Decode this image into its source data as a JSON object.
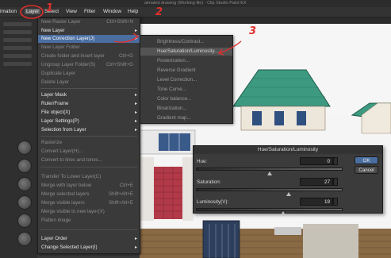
{
  "window": {
    "title_text": "aimated drawing (Working file) - Clip Studio Paint EX"
  },
  "menubar": {
    "items": [
      "imation",
      "Layer",
      "Select",
      "View",
      "Filter",
      "Window",
      "Help"
    ],
    "active": "Layer"
  },
  "layer_menu": {
    "items": [
      {
        "label": "New Raster Layer",
        "shortcut": "Ctrl+Shift+N",
        "submenu": false,
        "enabled": false
      },
      {
        "label": "New Layer",
        "shortcut": "",
        "submenu": true,
        "enabled": true
      },
      {
        "label": "New Correction Layer(J)",
        "shortcut": "",
        "submenu": true,
        "enabled": true,
        "highlighted": true
      },
      {
        "label": "New Layer Folder",
        "shortcut": "",
        "submenu": false,
        "enabled": false
      },
      {
        "label": "Create folder and insert layer",
        "shortcut": "Ctrl+G",
        "submenu": false,
        "enabled": false
      },
      {
        "label": "Ungroup Layer Folder(S)",
        "shortcut": "Ctrl+Shift+G",
        "submenu": false,
        "enabled": false
      },
      {
        "label": "Duplicate Layer",
        "shortcut": "",
        "submenu": false,
        "enabled": false
      },
      {
        "label": "Delete Layer",
        "shortcut": "",
        "submenu": false,
        "enabled": false
      },
      {
        "label": "Layer Mask",
        "shortcut": "",
        "submenu": true,
        "enabled": true
      },
      {
        "label": "Ruler/Frame",
        "shortcut": "",
        "submenu": true,
        "enabled": true
      },
      {
        "label": "File object(X)",
        "shortcut": "",
        "submenu": true,
        "enabled": true
      },
      {
        "label": "Layer Settings(P)",
        "shortcut": "",
        "submenu": true,
        "enabled": true
      },
      {
        "label": "Selection from Layer",
        "shortcut": "",
        "submenu": true,
        "enabled": true
      },
      {
        "label": "Rasterize",
        "shortcut": "",
        "submenu": false,
        "enabled": false
      },
      {
        "label": "Convert Layer(H)...",
        "shortcut": "",
        "submenu": false,
        "enabled": false
      },
      {
        "label": "Convert to lines and tones...",
        "shortcut": "",
        "submenu": false,
        "enabled": false
      },
      {
        "label": "Transfer To Lower Layer(C)",
        "shortcut": "",
        "submenu": false,
        "enabled": false
      },
      {
        "label": "Merge with layer below",
        "shortcut": "Ctrl+E",
        "submenu": false,
        "enabled": false
      },
      {
        "label": "Merge selected layers",
        "shortcut": "Shift+Alt+E",
        "submenu": false,
        "enabled": false
      },
      {
        "label": "Merge visible layers",
        "shortcut": "Shift+Alt+E",
        "submenu": false,
        "enabled": false
      },
      {
        "label": "Merge visible to new layer(X)",
        "shortcut": "",
        "submenu": false,
        "enabled": false
      },
      {
        "label": "Flatten image",
        "shortcut": "",
        "submenu": false,
        "enabled": false
      },
      {
        "label": "Layer Order",
        "shortcut": "",
        "submenu": true,
        "enabled": true
      },
      {
        "label": "Change Selected Layer(I)",
        "shortcut": "",
        "submenu": true,
        "enabled": true
      }
    ]
  },
  "correction_submenu": {
    "items": [
      {
        "label": "Brightness/Contrast...",
        "highlighted": false
      },
      {
        "label": "Hue/Saturation/Luminosity...",
        "highlighted": true
      },
      {
        "label": "Posterization...",
        "highlighted": false
      },
      {
        "label": "Reverse Gradient",
        "highlighted": false
      },
      {
        "label": "Level Correction...",
        "highlighted": false
      },
      {
        "label": "Tone Curve...",
        "highlighted": false
      },
      {
        "label": "Color balance...",
        "highlighted": false
      },
      {
        "label": "Binarization...",
        "highlighted": false
      },
      {
        "label": "Gradient map...",
        "highlighted": false
      }
    ]
  },
  "hsl_dialog": {
    "title": "Hue/Saturation/Luminosity",
    "hue": {
      "label": "Hue:",
      "value": "0",
      "level": 0.5
    },
    "saturation": {
      "label": "Saturation:",
      "value": "27",
      "level": 0.635
    },
    "luminosity": {
      "label": "Luminosity(V):",
      "value": "19",
      "level": 0.595
    },
    "ok_label": "OK",
    "cancel_label": "Cancel"
  },
  "annotations": {
    "step1": "1",
    "step2": "2",
    "step3": "3",
    "color": "#e0302e"
  },
  "colors": {
    "menu_highlight": "#4a6ea0",
    "roof_green": "#3d9a80",
    "brick_red": "#b23a48",
    "window_blue": "#2f4f7f",
    "wall_brown": "#8a6a45"
  }
}
